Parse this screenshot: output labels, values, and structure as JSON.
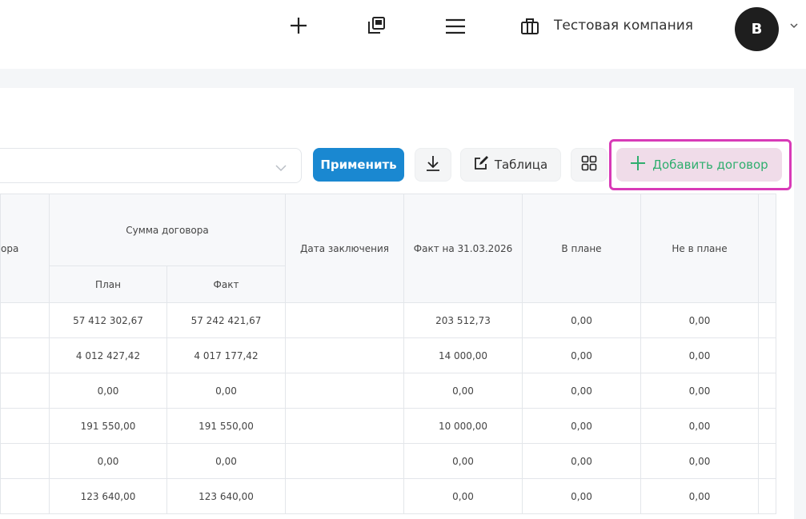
{
  "header": {
    "company_name": "Тестовая компания",
    "avatar_letter": "B",
    "icons": [
      "plus-icon",
      "copy-window-icon",
      "menu-icon",
      "briefcase-icon",
      "chevron-down-icon"
    ]
  },
  "toolbar": {
    "apply_label": "Применить",
    "table_label": "Таблица",
    "add_label": "Добавить договор",
    "apply_color": "#1a88d1",
    "add_text_color": "#2fae6e",
    "highlight_color": "#d83ab7"
  },
  "table": {
    "col_cut_label": "ора",
    "group_sum_label": "Сумма договора",
    "plan_label": "План",
    "fact_label": "Факт",
    "date_label": "Дата заключения",
    "fact_on_label": "Факт на 31.03.2026",
    "in_plan_label": "В плане",
    "not_in_plan_label": "Не в плане",
    "rows": [
      {
        "plan": "57 412 302,67",
        "fact": "57 242 421,67",
        "date": "",
        "fact_on": "203 512,73",
        "in_plan": "0,00",
        "not_in_plan": "0,00"
      },
      {
        "plan": "4 012 427,42",
        "fact": "4 017 177,42",
        "date": "",
        "fact_on": "14 000,00",
        "in_plan": "0,00",
        "not_in_plan": "0,00"
      },
      {
        "plan": "0,00",
        "fact": "0,00",
        "date": "",
        "fact_on": "0,00",
        "in_plan": "0,00",
        "not_in_plan": "0,00"
      },
      {
        "plan": "191 550,00",
        "fact": "191 550,00",
        "date": "",
        "fact_on": "10 000,00",
        "in_plan": "0,00",
        "not_in_plan": "0,00"
      },
      {
        "plan": "0,00",
        "fact": "0,00",
        "date": "",
        "fact_on": "0,00",
        "in_plan": "0,00",
        "not_in_plan": "0,00"
      },
      {
        "plan": "123 640,00",
        "fact": "123 640,00",
        "date": "",
        "fact_on": "0,00",
        "in_plan": "0,00",
        "not_in_plan": "0,00"
      }
    ]
  }
}
